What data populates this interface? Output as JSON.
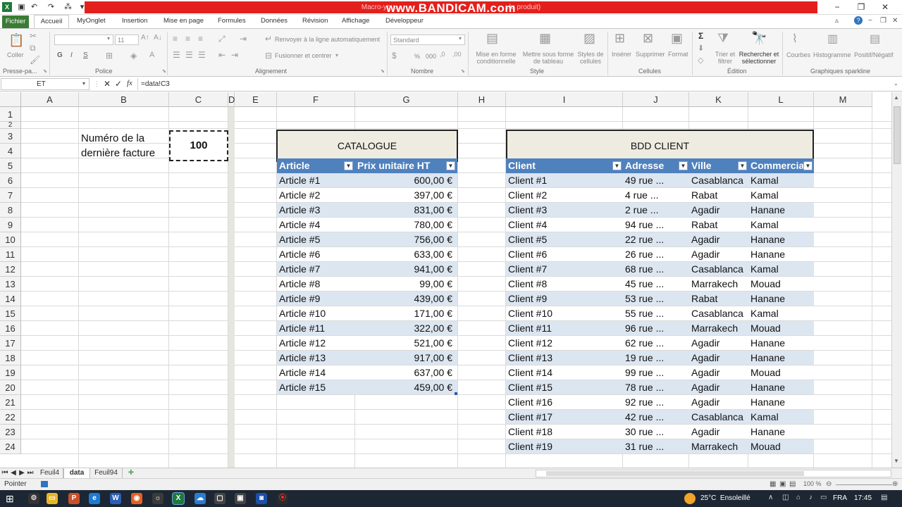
{
  "window": {
    "title": "Macro-you…",
    "watermark": "www.BANDICAM.com",
    "title_suffix": "…lu produit)"
  },
  "ribbon_tabs": [
    "Fichier",
    "Accueil",
    "MyOnglet",
    "Insertion",
    "Mise en page",
    "Formules",
    "Données",
    "Révision",
    "Affichage",
    "Développeur"
  ],
  "ribbon": {
    "clipboard": {
      "paste": "Coller",
      "label": "Presse-pa..."
    },
    "font": {
      "name": "",
      "size": "11",
      "bold": "G",
      "italic": "I",
      "underline": "S",
      "label": "Police"
    },
    "alignment": {
      "wrap": "Renvoyer à la ligne automatiquement",
      "merge": "Fusionner et centrer",
      "label": "Alignement"
    },
    "number": {
      "format": "Standard",
      "percent": "%",
      "thousands": "000",
      "label": "Nombre"
    },
    "style": {
      "cond": "Mise en forme\nconditionnelle",
      "table": "Mettre sous forme\nde tableau",
      "cellstyles": "Styles de\ncellules",
      "label": "Style"
    },
    "cells": {
      "insert": "Insérer",
      "delete": "Supprimer",
      "format": "Format",
      "label": "Cellules"
    },
    "editing": {
      "sum": "Σ",
      "sort": "Trier et\nfiltrer",
      "find": "Rechercher et\nsélectionner",
      "label": "Édition"
    },
    "sparkline": {
      "lines": "Courbes",
      "histo": "Histogramme",
      "posneg": "Positif/Négatif",
      "label": "Graphiques sparkline"
    }
  },
  "formula_bar": {
    "name_box": "ET",
    "fx": "fx",
    "formula": "=data!C3"
  },
  "columns": [
    "A",
    "B",
    "C",
    "D",
    "E",
    "F",
    "G",
    "H",
    "I",
    "J",
    "K",
    "L",
    "M"
  ],
  "rows": [
    "1",
    "2",
    "3",
    "4",
    "5",
    "6",
    "7",
    "8",
    "9",
    "10",
    "11",
    "12",
    "13",
    "14",
    "15",
    "16",
    "17",
    "18",
    "19",
    "20",
    "21",
    "22",
    "23",
    "24"
  ],
  "invoice": {
    "label_line1": "Numéro de la",
    "label_line2": "dernière facture",
    "value": "100"
  },
  "catalogue": {
    "title": "CATALOGUE",
    "headers": [
      "Article",
      "Prix unitaire HT"
    ],
    "rows": [
      [
        "Article #1",
        "600,00 €"
      ],
      [
        "Article #2",
        "397,00 €"
      ],
      [
        "Article #3",
        "831,00 €"
      ],
      [
        "Article #4",
        "780,00 €"
      ],
      [
        "Article #5",
        "756,00 €"
      ],
      [
        "Article #6",
        "633,00 €"
      ],
      [
        "Article #7",
        "941,00 €"
      ],
      [
        "Article #8",
        "99,00 €"
      ],
      [
        "Article #9",
        "439,00 €"
      ],
      [
        "Article #10",
        "171,00 €"
      ],
      [
        "Article #11",
        "322,00 €"
      ],
      [
        "Article #12",
        "521,00 €"
      ],
      [
        "Article #13",
        "917,00 €"
      ],
      [
        "Article #14",
        "637,00 €"
      ],
      [
        "Article #15",
        "459,00 €"
      ]
    ]
  },
  "clients": {
    "title": "BDD CLIENT",
    "headers": [
      "Client",
      "Adresse",
      "Ville",
      "Commercial"
    ],
    "rows": [
      [
        "Client #1",
        "49 rue ...",
        "Casablanca",
        "Kamal"
      ],
      [
        "Client #2",
        "4 rue ...",
        "Rabat",
        "Kamal"
      ],
      [
        "Client #3",
        "2 rue ...",
        "Agadir",
        "Hanane"
      ],
      [
        "Client #4",
        "94 rue ...",
        "Rabat",
        "Kamal"
      ],
      [
        "Client #5",
        "22 rue ...",
        "Agadir",
        "Hanane"
      ],
      [
        "Client #6",
        "26 rue ...",
        "Agadir",
        "Hanane"
      ],
      [
        "Client #7",
        "68 rue ...",
        "Casablanca",
        "Kamal"
      ],
      [
        "Client #8",
        "45 rue ...",
        "Marrakech",
        "Mouad"
      ],
      [
        "Client #9",
        "53 rue ...",
        "Rabat",
        "Hanane"
      ],
      [
        "Client #10",
        "55 rue ...",
        "Casablanca",
        "Kamal"
      ],
      [
        "Client #11",
        "96 rue ...",
        "Marrakech",
        "Mouad"
      ],
      [
        "Client #12",
        "62 rue ...",
        "Agadir",
        "Hanane"
      ],
      [
        "Client #13",
        "19 rue ...",
        "Agadir",
        "Hanane"
      ],
      [
        "Client #14",
        "99 rue ...",
        "Agadir",
        "Mouad"
      ],
      [
        "Client #15",
        "78 rue ...",
        "Agadir",
        "Hanane"
      ],
      [
        "Client #16",
        "92 rue ...",
        "Agadir",
        "Hanane"
      ],
      [
        "Client #17",
        "42 rue ...",
        "Casablanca",
        "Kamal"
      ],
      [
        "Client #18",
        "30 rue ...",
        "Agadir",
        "Hanane"
      ],
      [
        "Client #19",
        "31 rue ...",
        "Marrakech",
        "Mouad"
      ]
    ]
  },
  "sheet_tabs": [
    "Feuil4",
    "data",
    "Feuil94"
  ],
  "status": {
    "mode": "Pointer",
    "zoom": "100 %"
  },
  "taskbar": {
    "weather": "25°C  Ensoleillé",
    "lang": "FRA",
    "time": "17:45"
  },
  "colors": {
    "excel_green": "#3a7c33",
    "table_header": "#4f81bd",
    "band": "#dce6f1",
    "title_box": "#eeece1",
    "record_bar": "#e3201c"
  }
}
